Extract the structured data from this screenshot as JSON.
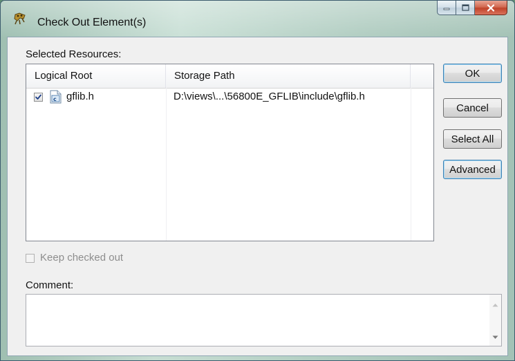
{
  "window": {
    "title": "Check Out Element(s)",
    "app_icon": "clearcase-icon",
    "controls": [
      "minimize-icon",
      "maximize-icon",
      "close-icon"
    ]
  },
  "resources": {
    "label": "Selected Resources:",
    "columns": [
      "Logical Root",
      "Storage Path"
    ],
    "rows": [
      {
        "checked": true,
        "icon": "c-file-icon",
        "name": "gflib.h",
        "path": "D:\\views\\...\\56800E_GFLIB\\include\\gflib.h"
      }
    ]
  },
  "buttons": {
    "ok": "OK",
    "cancel": "Cancel",
    "select_all": "Select All",
    "advanced": "Advanced"
  },
  "keep_checked_out": {
    "label": "Keep checked out",
    "checked": false,
    "enabled": false
  },
  "comment": {
    "label": "Comment:",
    "value": ""
  },
  "colors": {
    "accent": "#3c7fb1",
    "close_button": "#c0432a"
  }
}
